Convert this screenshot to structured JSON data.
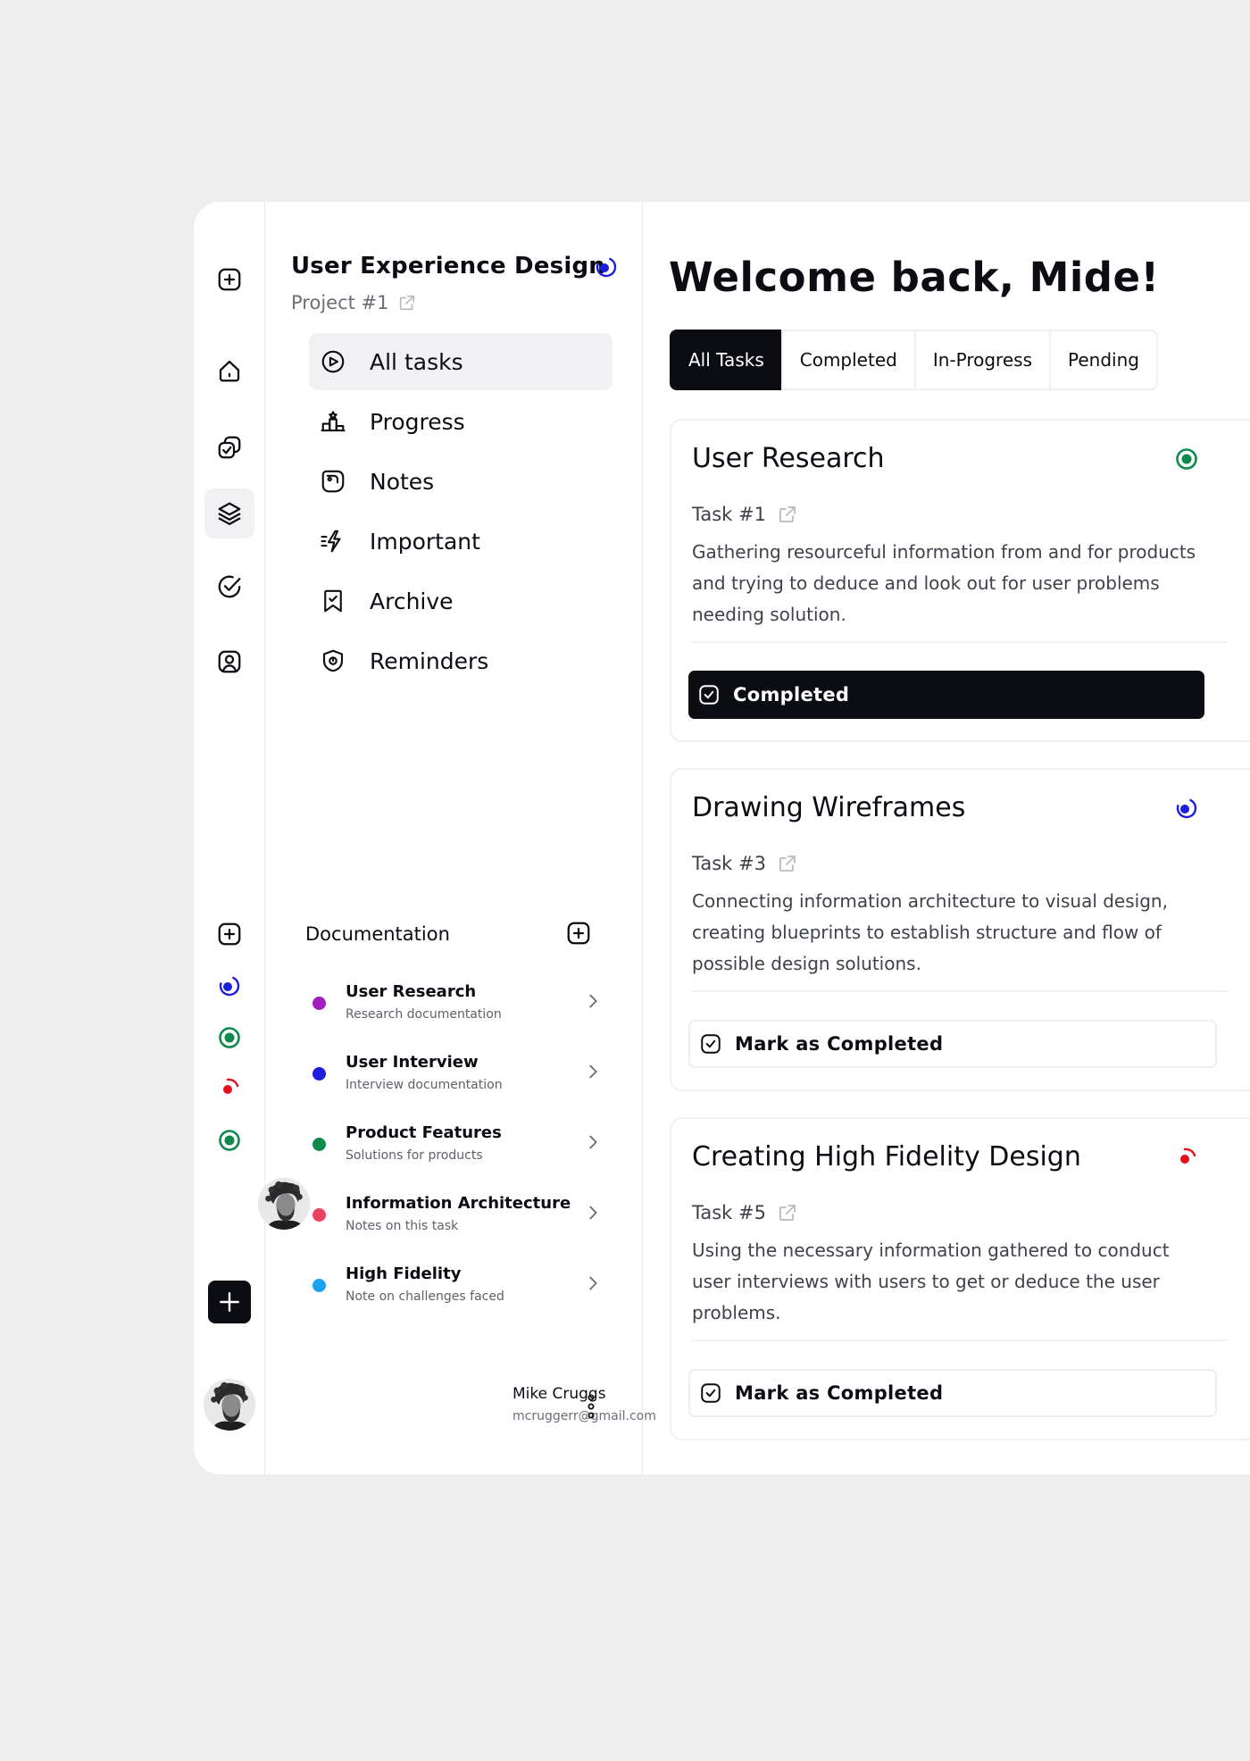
{
  "colors": {
    "background": "#eeeeef",
    "accent_dark": "#0b0d12",
    "blue": "#1d1ddc",
    "green": "#0e8a4d",
    "red": "#e5101a"
  },
  "rail": {
    "top_icons": [
      "plus-square-icon",
      "home-icon",
      "copy-check-icon",
      "layers-icon",
      "circle-check-icon",
      "user-square-icon"
    ],
    "active": "layers-icon",
    "status_icons": [
      "plus-square-icon",
      "in-progress-blue-icon",
      "completed-green-icon",
      "pending-red-icon",
      "completed-green-icon"
    ]
  },
  "project": {
    "title": "User Experience Design",
    "subtitle": "Project #1"
  },
  "nav": [
    {
      "label": "All tasks",
      "icon": "play-circle-icon",
      "active": true
    },
    {
      "label": "Progress",
      "icon": "podium-icon",
      "active": false
    },
    {
      "label": "Notes",
      "icon": "notes-icon",
      "active": false
    },
    {
      "label": "Important",
      "icon": "lightning-icon",
      "active": false
    },
    {
      "label": "Archive",
      "icon": "bookmark-icon",
      "active": false
    },
    {
      "label": "Reminders",
      "icon": "shield-icon",
      "active": false
    }
  ],
  "documentation": {
    "title": "Documentation",
    "items": [
      {
        "title": "User Research",
        "subtitle": "Research documentation",
        "color": "#a01fbf"
      },
      {
        "title": "User Interview",
        "subtitle": "Interview documentation",
        "color": "#1d1ddc"
      },
      {
        "title": "Product Features",
        "subtitle": "Solutions for products",
        "color": "#0e8a4d"
      },
      {
        "title": "Information Architecture",
        "subtitle": "Notes on this task",
        "color": "#ea4361"
      },
      {
        "title": "High Fidelity",
        "subtitle": "Note on challenges faced",
        "color": "#1aa3f2"
      }
    ]
  },
  "user": {
    "name": "Mike Cruggs",
    "email": "mcruggerr@gmail.com"
  },
  "main": {
    "welcome": "Welcome back, Mide!",
    "tabs": [
      {
        "label": "All Tasks",
        "active": true
      },
      {
        "label": "Completed",
        "active": false
      },
      {
        "label": "In-Progress",
        "active": false
      },
      {
        "label": "Pending",
        "active": false
      }
    ],
    "cards": [
      {
        "title": "User Research",
        "task": "Task #1",
        "description": "Gathering resourceful information from and for products and trying to deduce and look out for user problems needing solution.",
        "status_icon": "completed-green-icon",
        "button": "Completed",
        "button_style": "done"
      },
      {
        "title": "Drawing Wireframes",
        "task": "Task #3",
        "description": "Connecting information architecture to visual design, creating blueprints to establish structure and flow of possible design solutions.",
        "status_icon": "in-progress-blue-icon",
        "button": "Mark as Completed",
        "button_style": "todo"
      },
      {
        "title": "Creating High Fidelity Design",
        "task": "Task #5",
        "description": "Using the necessary information gathered to conduct user interviews with users to get or deduce the user problems.",
        "status_icon": "pending-red-icon",
        "button": "Mark as Completed",
        "button_style": "todo"
      }
    ]
  }
}
